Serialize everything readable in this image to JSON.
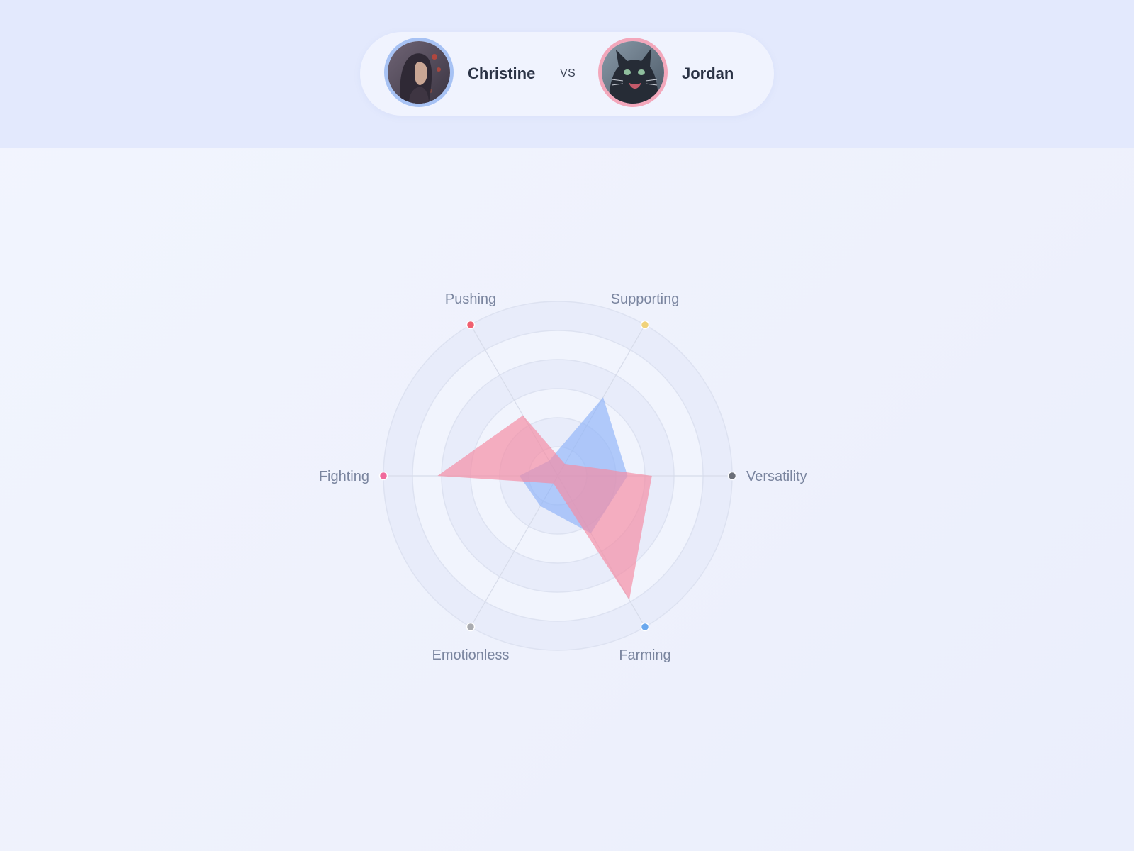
{
  "header": {
    "player_left": {
      "name": "Christine",
      "avatar_icon": "woman-portrait-photo",
      "ring_color": "#a7c2f4"
    },
    "vs_label": "VS",
    "player_right": {
      "name": "Jordan",
      "avatar_icon": "black-cat-photo",
      "ring_color": "#f3a7bb"
    }
  },
  "chart_data": {
    "type": "radar",
    "title": "",
    "axes": [
      "Versatility",
      "Farming",
      "Emotionless",
      "Fighting",
      "Pushing",
      "Supporting"
    ],
    "axis_dot_colors": [
      "#6b6f78",
      "#6aa8ee",
      "#a9abb0",
      "#f06a9c",
      "#f06070",
      "#f0d27a"
    ],
    "range": [
      0,
      100
    ],
    "rings": 6,
    "grid": true,
    "legend": "none",
    "series": [
      {
        "values": [
          40,
          38,
          20,
          22,
          10,
          52
        ],
        "color": "#90b4f8"
      },
      {
        "values": [
          54,
          82,
          5,
          69,
          40,
          8
        ],
        "color": "#f48aa2"
      }
    ]
  }
}
